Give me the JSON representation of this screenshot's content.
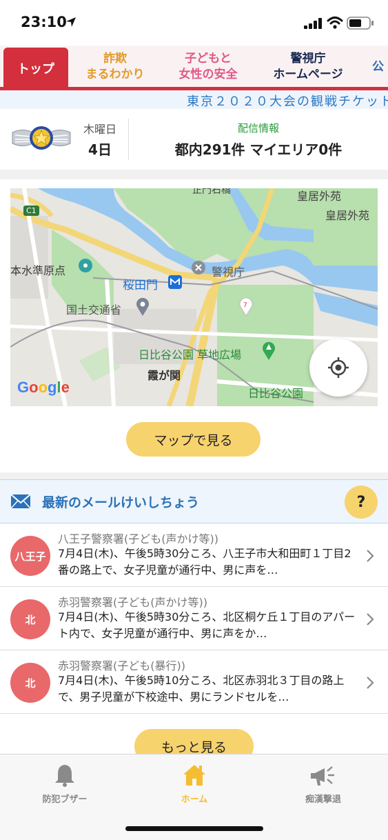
{
  "status_bar": {
    "time": "23:10"
  },
  "tabs": [
    {
      "label": "トップ",
      "active": true
    },
    {
      "label": "詐欺\nまるわかり"
    },
    {
      "label": "子どもと\n女性の安全"
    },
    {
      "label": "警視庁\nホームページ"
    },
    {
      "label": "公"
    }
  ],
  "ticker": {
    "text": "東京２０２０大会の観戦チケット"
  },
  "info": {
    "weekday": "木曜日",
    "day": "4日",
    "delivery_label": "配信情報",
    "delivery_count": "都内291件 マイエリア0件"
  },
  "map": {
    "labels": {
      "kokyo_gaien_1": "皇居外苑",
      "kokyo_gaien_2": "皇居外苑",
      "c1": "C1",
      "suijun": "本水準原点",
      "sakuradamon": "桜田門",
      "keishicho": "警視庁",
      "kokudo": "国土交通省",
      "hibiya_lawn": "日比谷公園 草地広場",
      "kasumigaseki": "霞が関",
      "hibiya_park": "日比谷公園",
      "top_cut": "正門石橋"
    },
    "google_logo": "Google",
    "view_button": "マップで見る"
  },
  "mail": {
    "title": "最新のメールけいしちょう",
    "help": "?",
    "items": [
      {
        "badge": "八王子",
        "station": "八王子警察署(子ども(声かけ等))",
        "body": "7月4日(木)、午後5時30分ころ、八王子市大和田町１丁目2番の路上で、女子児童が通行中、男に声を…"
      },
      {
        "badge": "北",
        "station": "赤羽警察署(子ども(声かけ等))",
        "body": "7月4日(木)、午後5時30分ころ、北区桐ケ丘１丁目のアパート内で、女子児童が通行中、男に声をか…"
      },
      {
        "badge": "北",
        "station": "赤羽警察署(子ども(暴行))",
        "body": "7月4日(木)、午後5時10分ころ、北区赤羽北３丁目の路上で、男子児童が下校途中、男にランドセルを…"
      }
    ],
    "more_button": "もっと見る"
  },
  "bottom_nav": [
    {
      "label": "防犯ブザー",
      "icon": "bell-icon"
    },
    {
      "label": "ホーム",
      "icon": "home-icon",
      "active": true
    },
    {
      "label": "痴漢撃退",
      "icon": "megaphone-icon"
    }
  ],
  "colors": {
    "accent_red": "#d32f3c",
    "button_yellow": "#f7d36e",
    "badge_red": "#e9686a",
    "link_blue": "#2b72b8"
  }
}
